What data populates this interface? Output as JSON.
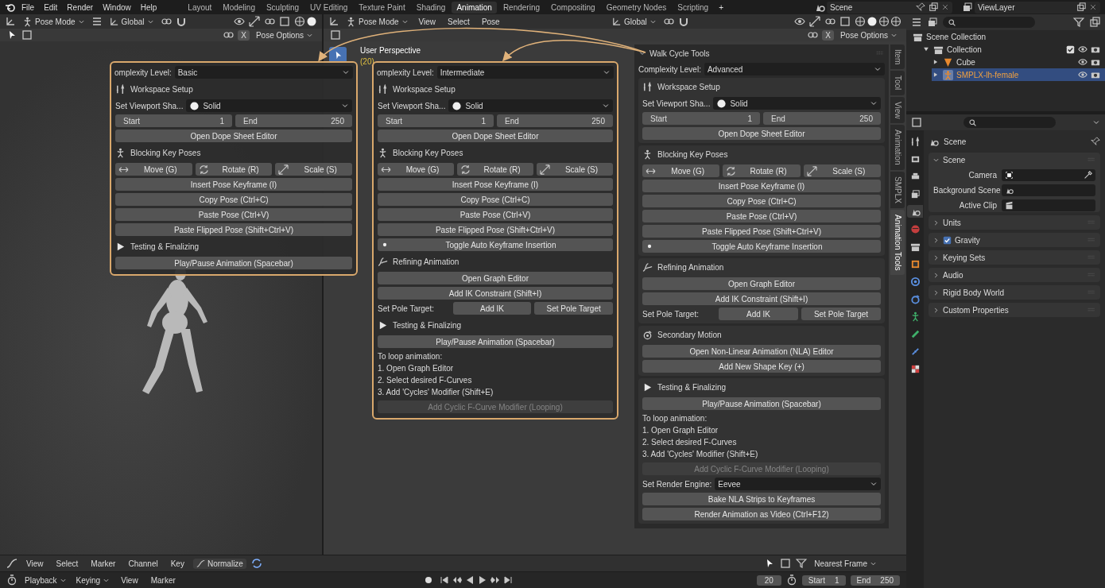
{
  "top_bar": {
    "menus": [
      "File",
      "Edit",
      "Render",
      "Window",
      "Help"
    ],
    "workspaces": [
      {
        "label": "Layout",
        "selected": false
      },
      {
        "label": "Modeling",
        "selected": false
      },
      {
        "label": "Sculpting",
        "selected": false
      },
      {
        "label": "UV Editing",
        "selected": false
      },
      {
        "label": "Texture Paint",
        "selected": false
      },
      {
        "label": "Shading",
        "selected": false
      },
      {
        "label": "Animation",
        "selected": true
      },
      {
        "label": "Rendering",
        "selected": false
      },
      {
        "label": "Compositing",
        "selected": false
      },
      {
        "label": "Geometry Nodes",
        "selected": false
      },
      {
        "label": "Scripting",
        "selected": false
      }
    ],
    "add_label": "+",
    "scene": "Scene",
    "view_layer": "ViewLayer"
  },
  "left_viewport": {
    "header": {
      "mode": "Pose Mode",
      "orientation": "Global",
      "x_label": "X",
      "options": "Pose Options"
    }
  },
  "main_viewport": {
    "header": {
      "mode": "Pose Mode",
      "menus": [
        "View",
        "Select",
        "Pose"
      ],
      "orientation": "Global",
      "x_label": "X",
      "options": "Pose Options"
    },
    "perspective": "User Perspective",
    "frame_info": "(20)"
  },
  "overlay_panels": [
    {
      "complexity_label": "omplexity Level:",
      "complexity_value": "Basic",
      "sections": [
        {
          "kind": "workspace",
          "title": "Workspace Setup",
          "rows": [
            {
              "kind": "shading",
              "label": "Set Viewport Sha...",
              "value": "Solid"
            },
            {
              "kind": "range",
              "start_label": "Start",
              "start_value": "1",
              "end_label": "End",
              "end_value": "250"
            },
            {
              "kind": "button",
              "label": "Open Dope Sheet Editor",
              "disabled": false
            }
          ]
        },
        {
          "kind": "blocking",
          "title": "Blocking Key Poses",
          "rows": [
            {
              "kind": "transform",
              "buttons": [
                "Move (G)",
                "Rotate (R)",
                "Scale (S)"
              ]
            },
            {
              "kind": "button",
              "label": "Insert Pose Keyframe (I)",
              "disabled": false
            },
            {
              "kind": "button",
              "label": "Copy Pose (Ctrl+C)",
              "disabled": false
            },
            {
              "kind": "button",
              "label": "Paste Pose (Ctrl+V)",
              "disabled": false
            },
            {
              "kind": "button",
              "label": "Paste Flipped Pose (Shift+Ctrl+V)",
              "disabled": false
            }
          ]
        },
        {
          "kind": "testing",
          "title": "Testing & Finalizing",
          "rows": [
            {
              "kind": "button",
              "label": "Play/Pause Animation (Spacebar)",
              "disabled": false
            }
          ]
        }
      ]
    },
    {
      "complexity_label": "omplexity Level:",
      "complexity_value": "Intermediate",
      "sections": [
        {
          "kind": "workspace",
          "title": "Workspace Setup",
          "rows": [
            {
              "kind": "shading",
              "label": "Set Viewport Sha...",
              "value": "Solid"
            },
            {
              "kind": "range",
              "start_label": "Start",
              "start_value": "1",
              "end_label": "End",
              "end_value": "250"
            },
            {
              "kind": "button",
              "label": "Open Dope Sheet Editor",
              "disabled": false
            }
          ]
        },
        {
          "kind": "blocking",
          "title": "Blocking Key Poses",
          "rows": [
            {
              "kind": "transform",
              "buttons": [
                "Move (G)",
                "Rotate (R)",
                "Scale (S)"
              ]
            },
            {
              "kind": "button",
              "label": "Insert Pose Keyframe (I)",
              "disabled": false
            },
            {
              "kind": "button",
              "label": "Copy Pose (Ctrl+C)",
              "disabled": false
            },
            {
              "kind": "button",
              "label": "Paste Pose (Ctrl+V)",
              "disabled": false
            },
            {
              "kind": "button",
              "label": "Paste Flipped Pose (Shift+Ctrl+V)",
              "disabled": false
            },
            {
              "kind": "toggle",
              "label": "Toggle Auto Keyframe Insertion"
            }
          ]
        },
        {
          "kind": "refining",
          "title": "Refining Animation",
          "rows": [
            {
              "kind": "button",
              "label": "Open Graph Editor",
              "disabled": false
            },
            {
              "kind": "button",
              "label": "Add IK Constraint (Shift+I)",
              "disabled": false
            },
            {
              "kind": "pole",
              "label": "Set Pole Target:",
              "buttons": [
                "Add IK",
                "Set Pole Target"
              ]
            }
          ]
        },
        {
          "kind": "testing",
          "title": "Testing & Finalizing",
          "rows": [
            {
              "kind": "button",
              "label": "Play/Pause Animation (Spacebar)",
              "disabled": false
            },
            {
              "kind": "text",
              "text": "To loop animation:"
            },
            {
              "kind": "text",
              "text": "1. Open Graph Editor"
            },
            {
              "kind": "text",
              "text": "2. Select desired F-Curves"
            },
            {
              "kind": "text",
              "text": "3. Add 'Cycles' Modifier (Shift+E)"
            },
            {
              "kind": "button",
              "label": "Add Cyclic F-Curve Modifier (Looping)",
              "disabled": true
            }
          ]
        }
      ]
    }
  ],
  "walk_cycle": {
    "title": "Walk Cycle Tools",
    "expanded": true,
    "complexity_label": "Complexity Level:",
    "complexity_value": "Advanced",
    "sections": [
      {
        "kind": "workspace",
        "title": "Workspace Setup",
        "rows": [
          {
            "kind": "shading",
            "label": "Set Viewport Sha...",
            "value": "Solid"
          },
          {
            "kind": "range",
            "start_label": "Start",
            "start_value": "1",
            "end_label": "End",
            "end_value": "250"
          },
          {
            "kind": "button",
            "label": "Open Dope Sheet Editor",
            "disabled": false
          }
        ]
      },
      {
        "kind": "blocking",
        "title": "Blocking Key Poses",
        "rows": [
          {
            "kind": "transform",
            "buttons": [
              "Move (G)",
              "Rotate (R)",
              "Scale (S)"
            ]
          },
          {
            "kind": "button",
            "label": "Insert Pose Keyframe (I)",
            "disabled": false
          },
          {
            "kind": "button",
            "label": "Copy Pose (Ctrl+C)",
            "disabled": false
          },
          {
            "kind": "button",
            "label": "Paste Pose (Ctrl+V)",
            "disabled": false
          },
          {
            "kind": "button",
            "label": "Paste Flipped Pose (Shift+Ctrl+V)",
            "disabled": false
          },
          {
            "kind": "toggle",
            "label": "Toggle Auto Keyframe Insertion"
          }
        ]
      },
      {
        "kind": "refining",
        "title": "Refining Animation",
        "rows": [
          {
            "kind": "button",
            "label": "Open Graph Editor",
            "disabled": false
          },
          {
            "kind": "button",
            "label": "Add IK Constraint (Shift+I)",
            "disabled": false
          },
          {
            "kind": "pole",
            "label": "Set Pole Target:",
            "buttons": [
              "Add IK",
              "Set Pole Target"
            ]
          }
        ]
      },
      {
        "kind": "secondary",
        "title": "Secondary Motion",
        "rows": [
          {
            "kind": "button",
            "label": "Open Non-Linear Animation (NLA) Editor",
            "disabled": false
          },
          {
            "kind": "button",
            "label": "Add New Shape Key (+)",
            "disabled": false
          }
        ]
      },
      {
        "kind": "testing",
        "title": "Testing & Finalizing",
        "rows": [
          {
            "kind": "button",
            "label": "Play/Pause Animation (Spacebar)",
            "disabled": false
          },
          {
            "kind": "text",
            "text": "To loop animation:"
          },
          {
            "kind": "text",
            "text": "1. Open Graph Editor"
          },
          {
            "kind": "text",
            "text": "2. Select desired F-Curves"
          },
          {
            "kind": "text",
            "text": "3. Add 'Cycles' Modifier (Shift+E)"
          },
          {
            "kind": "button",
            "label": "Add Cyclic F-Curve Modifier (Looping)",
            "disabled": true
          },
          {
            "kind": "dropdown",
            "label": "Set Render Engine:",
            "value": "Eevee"
          },
          {
            "kind": "button",
            "label": "Bake NLA Strips to Keyframes",
            "disabled": false
          },
          {
            "kind": "button",
            "label": "Render Animation as Video (Ctrl+F12)",
            "disabled": false
          }
        ]
      }
    ]
  },
  "sidebar_tabs": [
    {
      "label": "Item",
      "selected": false
    },
    {
      "label": "Tool",
      "selected": false
    },
    {
      "label": "View",
      "selected": false
    },
    {
      "label": "Animation",
      "selected": false
    },
    {
      "label": "SMPLX",
      "selected": false
    },
    {
      "label": "Animation Tools",
      "selected": true
    }
  ],
  "outliner": {
    "items": [
      {
        "label": "Scene Collection",
        "kind": "scene-collection",
        "selected": false,
        "children": [
          {
            "label": "Collection",
            "kind": "collection",
            "selected": false,
            "expanded": true,
            "checked": true,
            "children": [
              {
                "label": "Cube",
                "kind": "mesh",
                "selected": false,
                "expanded": false
              },
              {
                "label": "SMPLX-lh-female",
                "kind": "armature",
                "selected": true,
                "expanded": false
              }
            ]
          }
        ]
      }
    ]
  },
  "properties": {
    "tabs": [
      {
        "kind": "tool",
        "selected": false
      },
      {
        "kind": "render",
        "selected": false
      },
      {
        "kind": "output",
        "selected": false
      },
      {
        "kind": "view-layer",
        "selected": false
      },
      {
        "kind": "scene",
        "selected": true
      },
      {
        "kind": "world",
        "selected": false
      },
      {
        "kind": "collection",
        "selected": false
      },
      {
        "kind": "object",
        "selected": false
      },
      {
        "kind": "modifier",
        "selected": false
      },
      {
        "kind": "physics",
        "selected": false
      },
      {
        "kind": "armature",
        "selected": false
      },
      {
        "kind": "bone",
        "selected": false
      },
      {
        "kind": "constraint",
        "selected": false
      },
      {
        "kind": "texture",
        "selected": false
      }
    ],
    "context": "Scene",
    "panels": [
      {
        "title": "Scene",
        "kind": "plain",
        "expanded": true,
        "fields": [
          {
            "label": "Camera"
          },
          {
            "label": "Background Scene"
          },
          {
            "label": "Active Clip"
          }
        ]
      },
      {
        "title": "Units",
        "kind": "plain",
        "expanded": false
      },
      {
        "title": "Gravity",
        "kind": "checkbox",
        "expanded": false,
        "checked": true
      },
      {
        "title": "Keying Sets",
        "kind": "plain",
        "expanded": false
      },
      {
        "title": "Audio",
        "kind": "plain",
        "expanded": false
      },
      {
        "title": "Rigid Body World",
        "kind": "plain",
        "expanded": false
      },
      {
        "title": "Custom Properties",
        "kind": "plain",
        "expanded": false
      }
    ]
  },
  "timeline": {
    "menus": [
      "View",
      "Select",
      "Marker",
      "Channel",
      "Key"
    ],
    "normalize": "Normalize",
    "snap": "Nearest Frame",
    "dropdown_menus": [
      "Playback",
      "Keying"
    ],
    "menus2": [
      "View",
      "Marker"
    ],
    "current_frame": "20",
    "start_label": "Start",
    "start": "1",
    "end_label": "End",
    "end": "250"
  }
}
